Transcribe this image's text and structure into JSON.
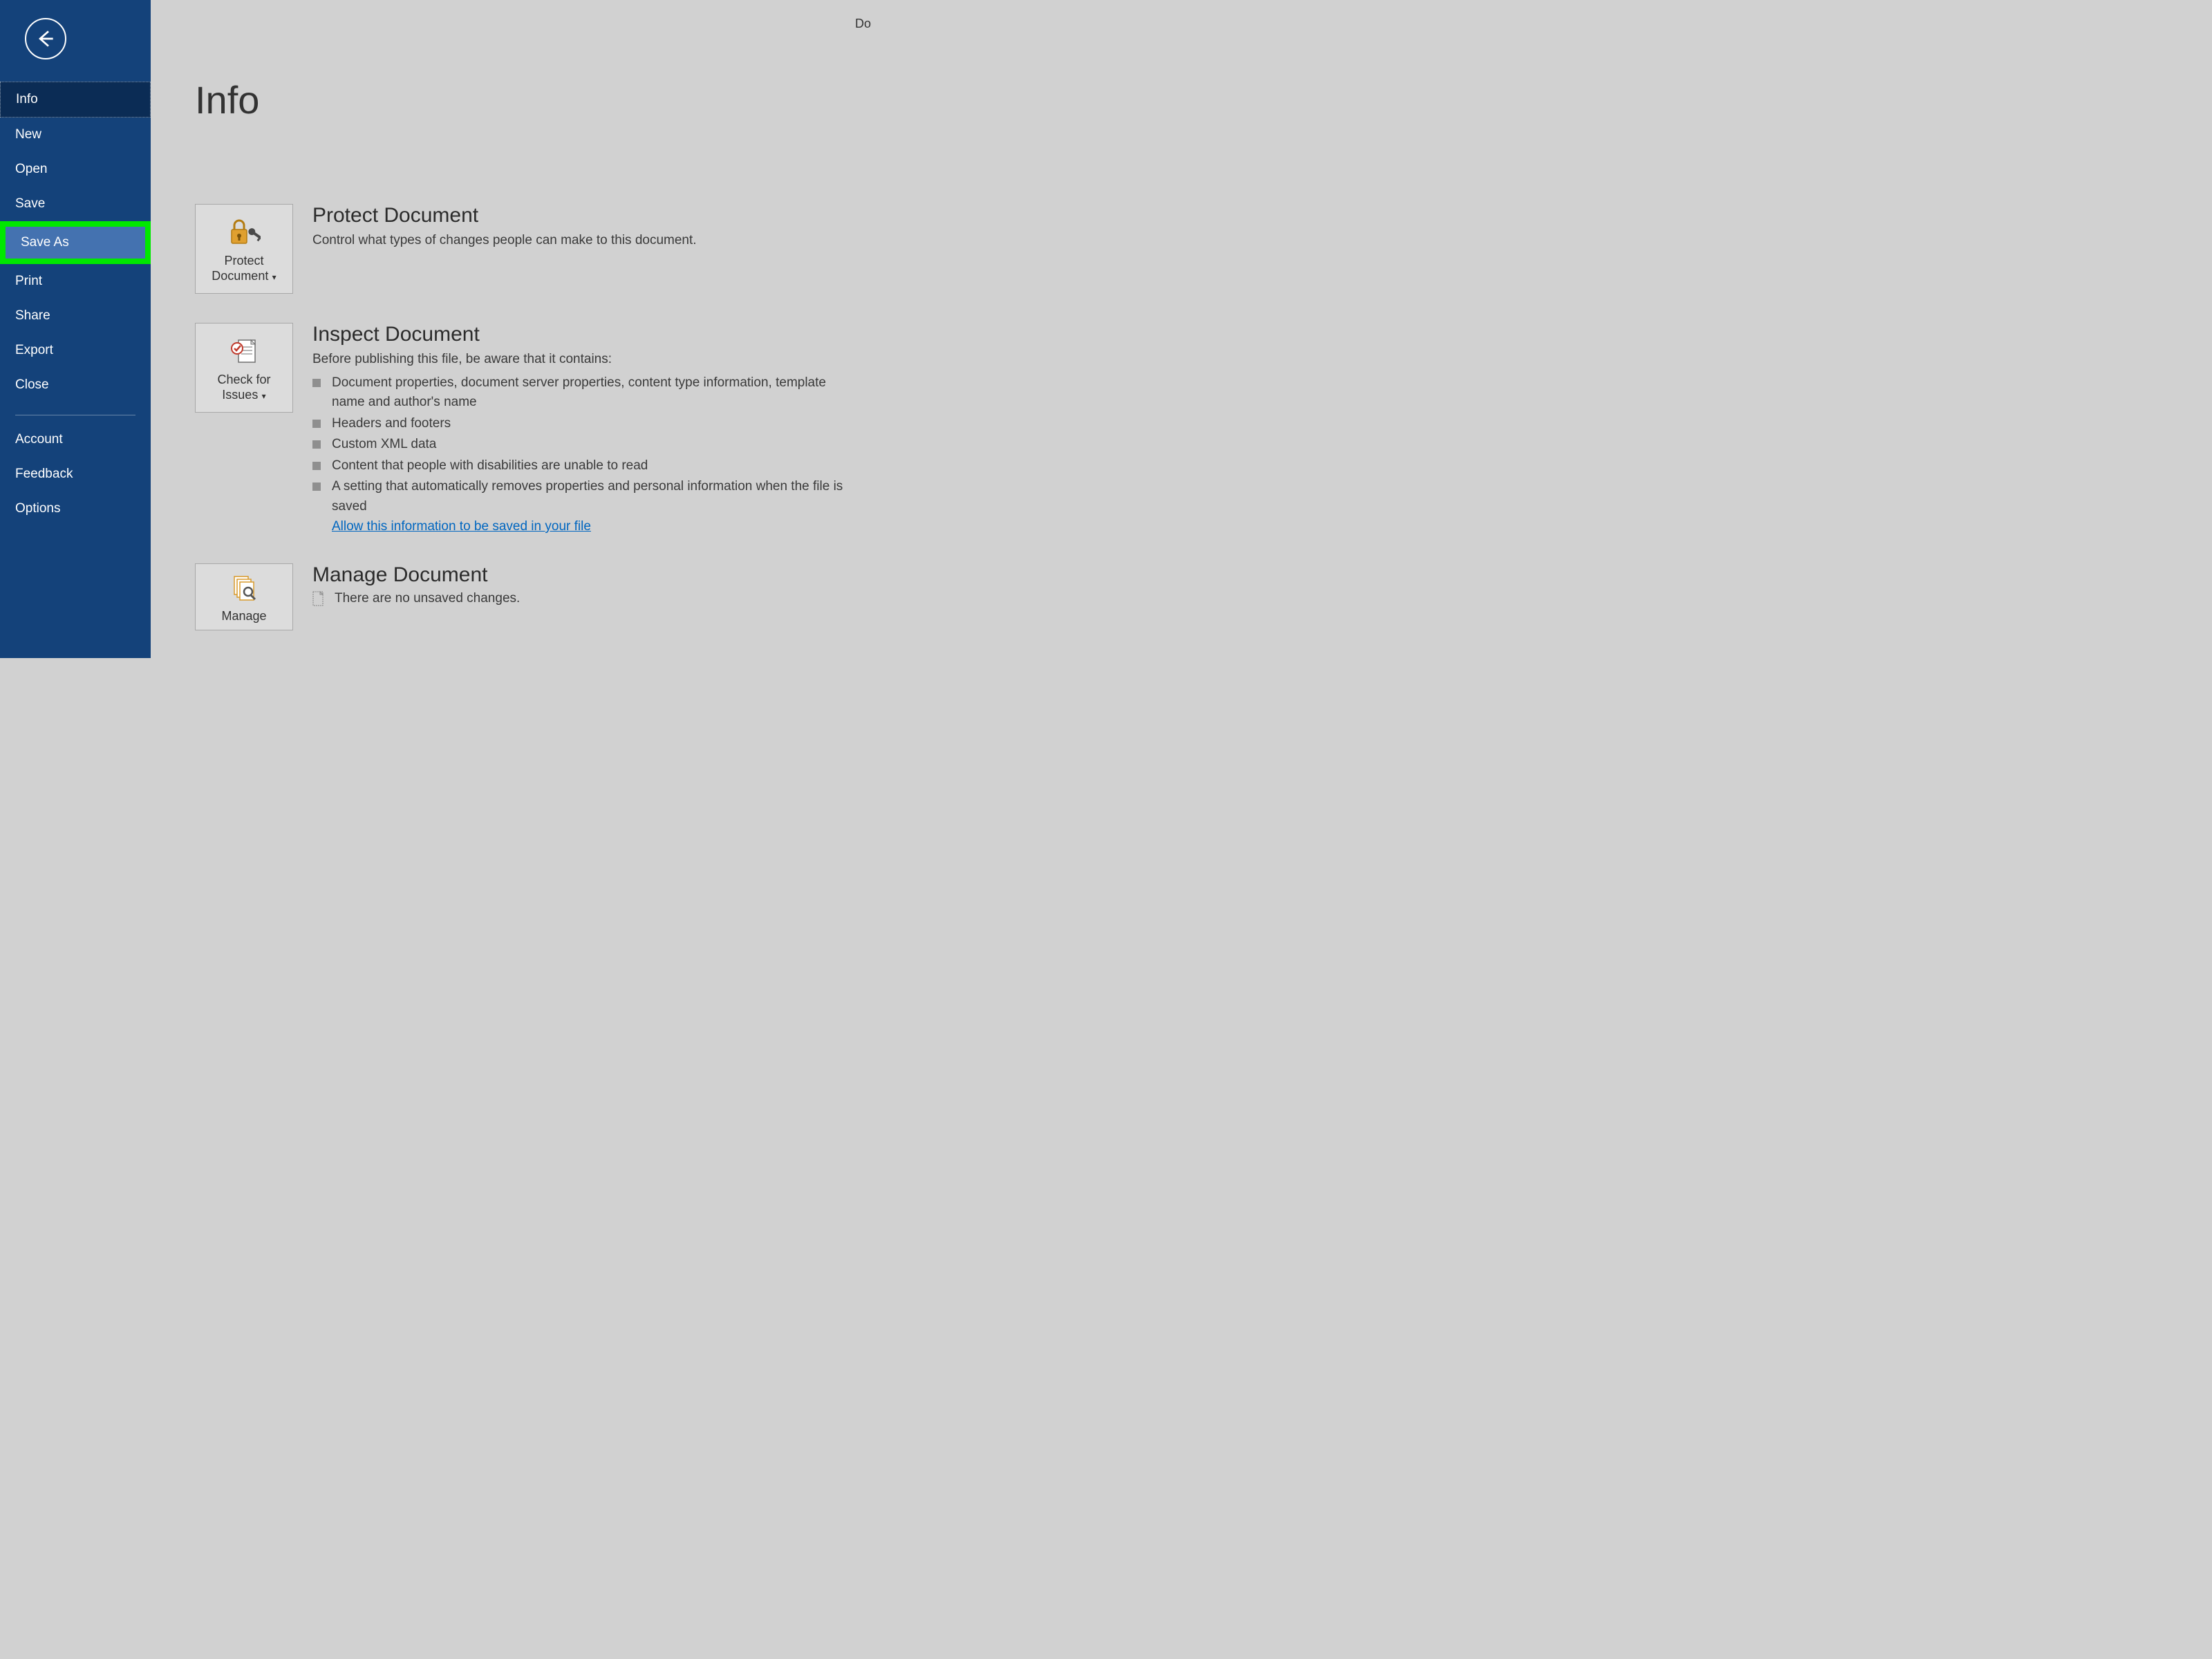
{
  "topRightText": "Do",
  "sidebar": {
    "items": [
      {
        "label": "Info",
        "state": "selected"
      },
      {
        "label": "New",
        "state": ""
      },
      {
        "label": "Open",
        "state": ""
      },
      {
        "label": "Save",
        "state": ""
      },
      {
        "label": "Save As",
        "state": "highlighted"
      },
      {
        "label": "Print",
        "state": ""
      },
      {
        "label": "Share",
        "state": ""
      },
      {
        "label": "Export",
        "state": ""
      },
      {
        "label": "Close",
        "state": ""
      }
    ],
    "footerItems": [
      {
        "label": "Account"
      },
      {
        "label": "Feedback"
      },
      {
        "label": "Options"
      }
    ]
  },
  "page": {
    "title": "Info",
    "protect": {
      "tileLabel": "Protect Document",
      "heading": "Protect Document",
      "desc": "Control what types of changes people can make to this document."
    },
    "inspect": {
      "tileLabel": "Check for Issues",
      "heading": "Inspect Document",
      "desc": "Before publishing this file, be aware that it contains:",
      "issues": [
        "Document properties, document server properties, content type information, template name and author's name",
        "Headers and footers",
        "Custom XML data",
        "Content that people with disabilities are unable to read",
        "A setting that automatically removes properties and personal information when the file is saved"
      ],
      "linkText": "Allow this information to be saved in your file"
    },
    "manage": {
      "tileLabel": "Manage",
      "heading": "Manage Document",
      "desc": "There are no unsaved changes."
    }
  },
  "colors": {
    "sidebarBg": "#14427a",
    "selectedBg": "#0b2c55",
    "highlightBorder": "#00e800",
    "highlightBg": "#4472b0",
    "mainBg": "#d1d1d1",
    "link": "#0066c0"
  }
}
